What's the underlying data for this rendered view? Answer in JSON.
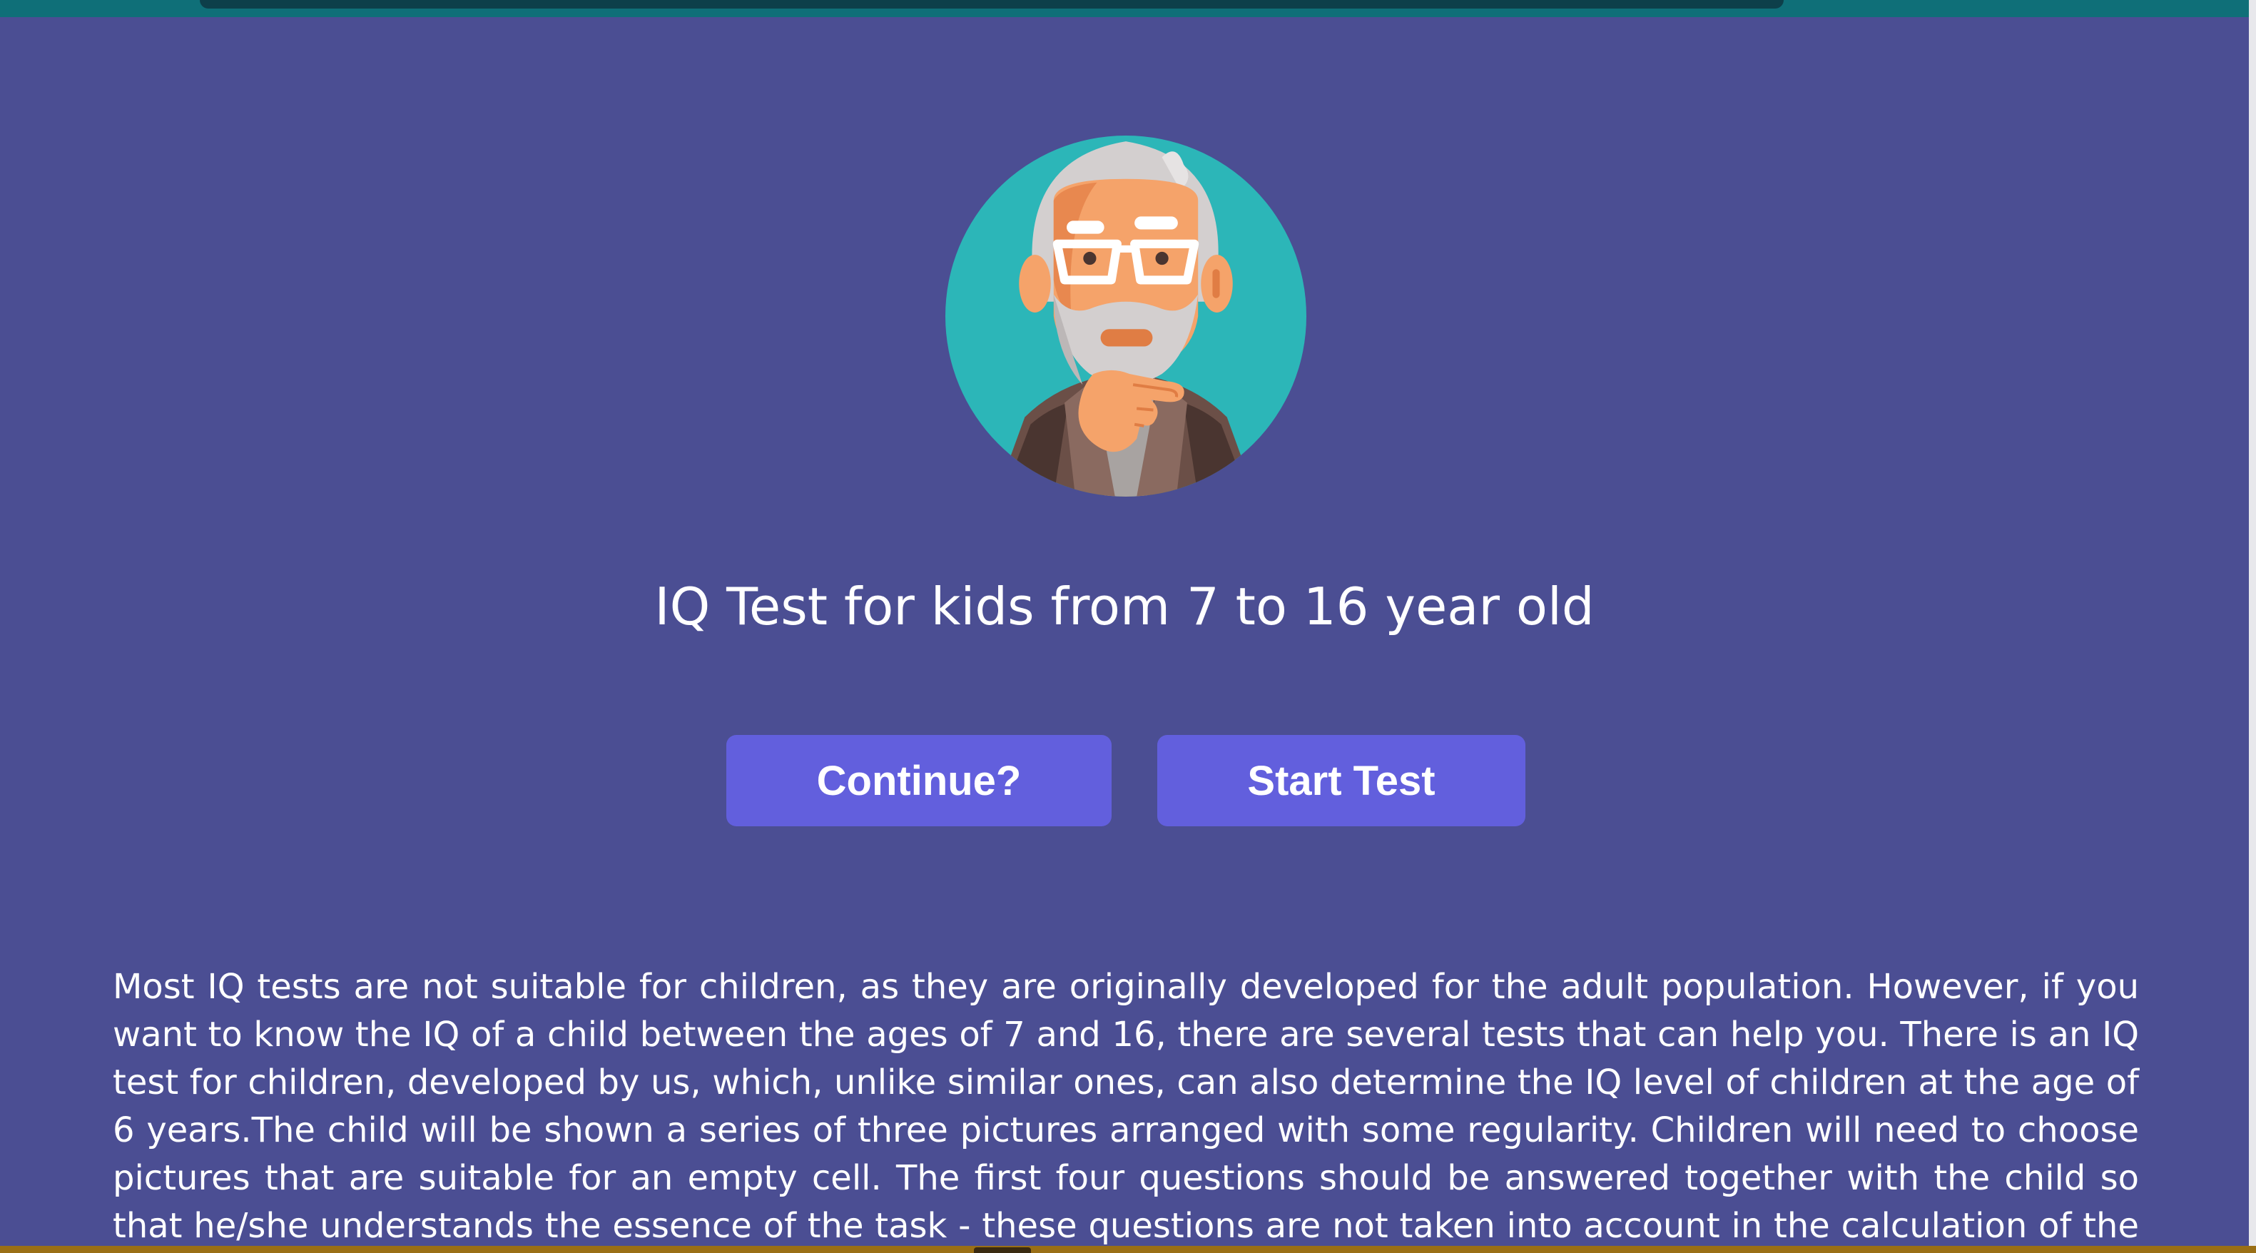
{
  "hero": {
    "avatar_icon": "thinking-old-man-avatar",
    "title": "IQ Test for kids from 7 to 16 year old"
  },
  "actions": {
    "continue_label": "Continue?",
    "start_label": "Start Test"
  },
  "description": "Most IQ tests are not suitable for children, as they are originally developed for the adult population. However, if you want to know the IQ of a child between the ages of 7 and 16, there are several tests that can help you. There is an IQ test for children, developed by us, which, unlike similar ones, can also determine the IQ level of children at the age of 6 years.The child will be shown a series of three pictures arranged with some regularity. Children will need to choose pictures that are suitable for an empty cell. The first four questions should be answered together with the child so that he/she understands the essence of the task - these questions are not taken into account in the calculation of the child’s IQ. Let's get started!",
  "colors": {
    "page_background": "#4b4e93",
    "button_background": "#625fdd",
    "avatar_background": "#2cb6b8",
    "text": "#ffffff"
  }
}
